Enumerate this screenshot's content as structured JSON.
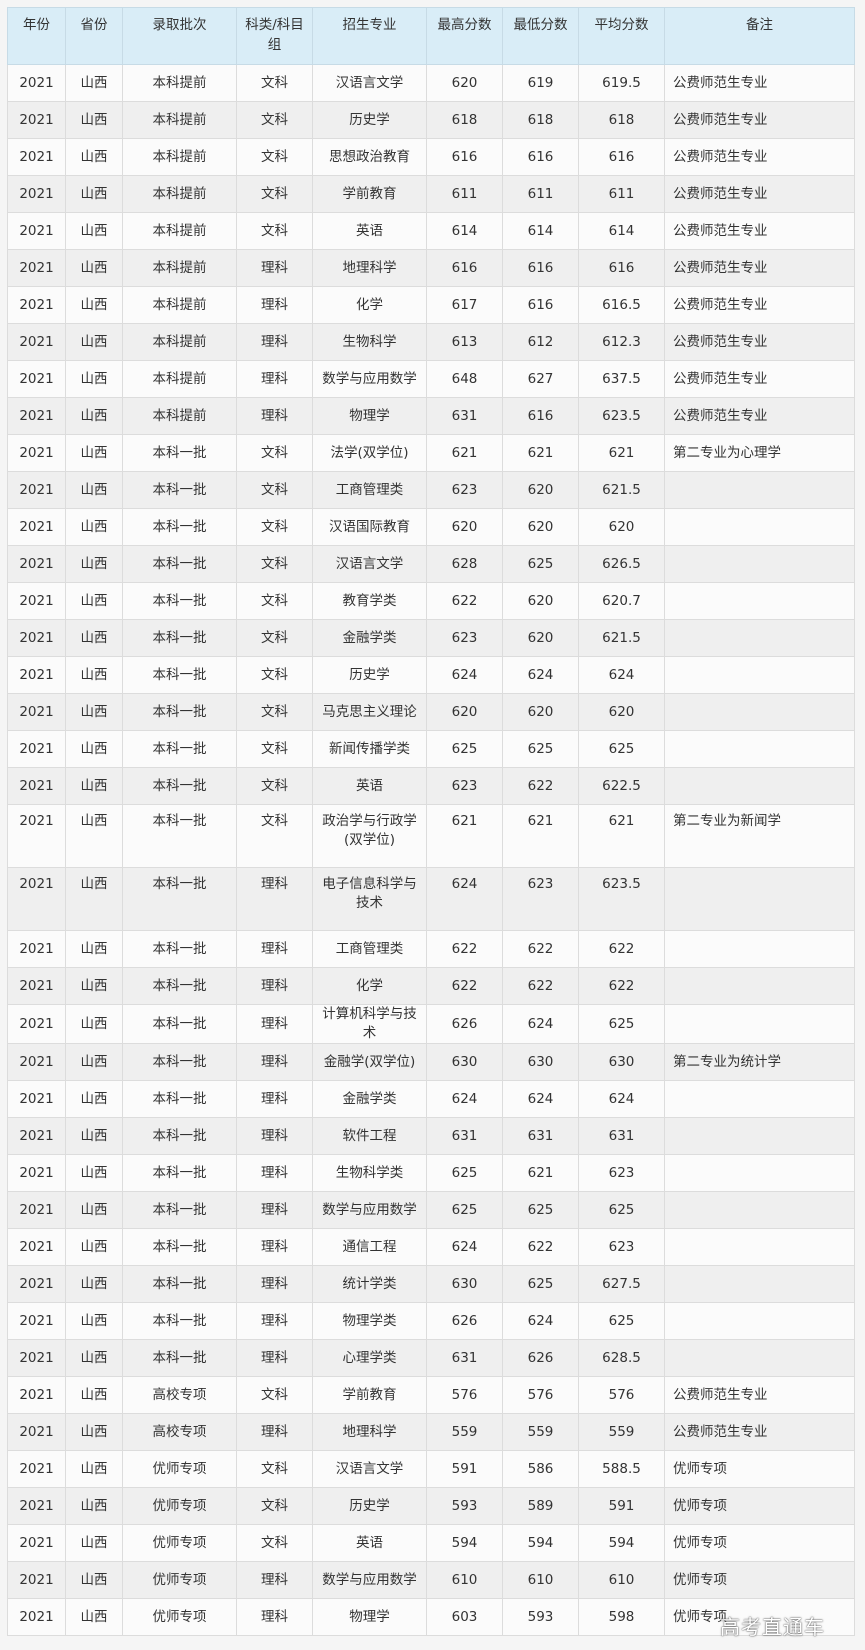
{
  "headers": [
    "年份",
    "省份",
    "录取批次",
    "科类/科目组",
    "招生专业",
    "最高分数",
    "最低分数",
    "平均分数",
    "备注"
  ],
  "rows": [
    [
      "2021",
      "山西",
      "本科提前",
      "文科",
      "汉语言文学",
      "620",
      "619",
      "619.5",
      "公费师范生专业"
    ],
    [
      "2021",
      "山西",
      "本科提前",
      "文科",
      "历史学",
      "618",
      "618",
      "618",
      "公费师范生专业"
    ],
    [
      "2021",
      "山西",
      "本科提前",
      "文科",
      "思想政治教育",
      "616",
      "616",
      "616",
      "公费师范生专业"
    ],
    [
      "2021",
      "山西",
      "本科提前",
      "文科",
      "学前教育",
      "611",
      "611",
      "611",
      "公费师范生专业"
    ],
    [
      "2021",
      "山西",
      "本科提前",
      "文科",
      "英语",
      "614",
      "614",
      "614",
      "公费师范生专业"
    ],
    [
      "2021",
      "山西",
      "本科提前",
      "理科",
      "地理科学",
      "616",
      "616",
      "616",
      "公费师范生专业"
    ],
    [
      "2021",
      "山西",
      "本科提前",
      "理科",
      "化学",
      "617",
      "616",
      "616.5",
      "公费师范生专业"
    ],
    [
      "2021",
      "山西",
      "本科提前",
      "理科",
      "生物科学",
      "613",
      "612",
      "612.3",
      "公费师范生专业"
    ],
    [
      "2021",
      "山西",
      "本科提前",
      "理科",
      "数学与应用数学",
      "648",
      "627",
      "637.5",
      "公费师范生专业"
    ],
    [
      "2021",
      "山西",
      "本科提前",
      "理科",
      "物理学",
      "631",
      "616",
      "623.5",
      "公费师范生专业"
    ],
    [
      "2021",
      "山西",
      "本科一批",
      "文科",
      "法学(双学位)",
      "621",
      "621",
      "621",
      "第二专业为心理学"
    ],
    [
      "2021",
      "山西",
      "本科一批",
      "文科",
      "工商管理类",
      "623",
      "620",
      "621.5",
      ""
    ],
    [
      "2021",
      "山西",
      "本科一批",
      "文科",
      "汉语国际教育",
      "620",
      "620",
      "620",
      ""
    ],
    [
      "2021",
      "山西",
      "本科一批",
      "文科",
      "汉语言文学",
      "628",
      "625",
      "626.5",
      ""
    ],
    [
      "2021",
      "山西",
      "本科一批",
      "文科",
      "教育学类",
      "622",
      "620",
      "620.7",
      ""
    ],
    [
      "2021",
      "山西",
      "本科一批",
      "文科",
      "金融学类",
      "623",
      "620",
      "621.5",
      ""
    ],
    [
      "2021",
      "山西",
      "本科一批",
      "文科",
      "历史学",
      "624",
      "624",
      "624",
      ""
    ],
    [
      "2021",
      "山西",
      "本科一批",
      "文科",
      "马克思主义理论",
      "620",
      "620",
      "620",
      ""
    ],
    [
      "2021",
      "山西",
      "本科一批",
      "文科",
      "新闻传播学类",
      "625",
      "625",
      "625",
      ""
    ],
    [
      "2021",
      "山西",
      "本科一批",
      "文科",
      "英语",
      "623",
      "622",
      "622.5",
      ""
    ],
    [
      "2021",
      "山西",
      "本科一批",
      "文科",
      "政治学与行政学(双学位)",
      "621",
      "621",
      "621",
      "第二专业为新闻学"
    ],
    [
      "2021",
      "山西",
      "本科一批",
      "理科",
      "电子信息科学与技术",
      "624",
      "623",
      "623.5",
      ""
    ],
    [
      "2021",
      "山西",
      "本科一批",
      "理科",
      "工商管理类",
      "622",
      "622",
      "622",
      ""
    ],
    [
      "2021",
      "山西",
      "本科一批",
      "理科",
      "化学",
      "622",
      "622",
      "622",
      ""
    ],
    [
      "2021",
      "山西",
      "本科一批",
      "理科",
      "计算机科学与技术",
      "626",
      "624",
      "625",
      ""
    ],
    [
      "2021",
      "山西",
      "本科一批",
      "理科",
      "金融学(双学位)",
      "630",
      "630",
      "630",
      "第二专业为统计学"
    ],
    [
      "2021",
      "山西",
      "本科一批",
      "理科",
      "金融学类",
      "624",
      "624",
      "624",
      ""
    ],
    [
      "2021",
      "山西",
      "本科一批",
      "理科",
      "软件工程",
      "631",
      "631",
      "631",
      ""
    ],
    [
      "2021",
      "山西",
      "本科一批",
      "理科",
      "生物科学类",
      "625",
      "621",
      "623",
      ""
    ],
    [
      "2021",
      "山西",
      "本科一批",
      "理科",
      "数学与应用数学",
      "625",
      "625",
      "625",
      ""
    ],
    [
      "2021",
      "山西",
      "本科一批",
      "理科",
      "通信工程",
      "624",
      "622",
      "623",
      ""
    ],
    [
      "2021",
      "山西",
      "本科一批",
      "理科",
      "统计学类",
      "630",
      "625",
      "627.5",
      ""
    ],
    [
      "2021",
      "山西",
      "本科一批",
      "理科",
      "物理学类",
      "626",
      "624",
      "625",
      ""
    ],
    [
      "2021",
      "山西",
      "本科一批",
      "理科",
      "心理学类",
      "631",
      "626",
      "628.5",
      ""
    ],
    [
      "2021",
      "山西",
      "高校专项",
      "文科",
      "学前教育",
      "576",
      "576",
      "576",
      "公费师范生专业"
    ],
    [
      "2021",
      "山西",
      "高校专项",
      "理科",
      "地理科学",
      "559",
      "559",
      "559",
      "公费师范生专业"
    ],
    [
      "2021",
      "山西",
      "优师专项",
      "文科",
      "汉语言文学",
      "591",
      "586",
      "588.5",
      "优师专项"
    ],
    [
      "2021",
      "山西",
      "优师专项",
      "文科",
      "历史学",
      "593",
      "589",
      "591",
      "优师专项"
    ],
    [
      "2021",
      "山西",
      "优师专项",
      "文科",
      "英语",
      "594",
      "594",
      "594",
      "优师专项"
    ],
    [
      "2021",
      "山西",
      "优师专项",
      "理科",
      "数学与应用数学",
      "610",
      "610",
      "610",
      "优师专项"
    ],
    [
      "2021",
      "山西",
      "优师专项",
      "理科",
      "物理学",
      "603",
      "593",
      "598",
      "优师专项"
    ]
  ],
  "watermark": "高考直通车"
}
